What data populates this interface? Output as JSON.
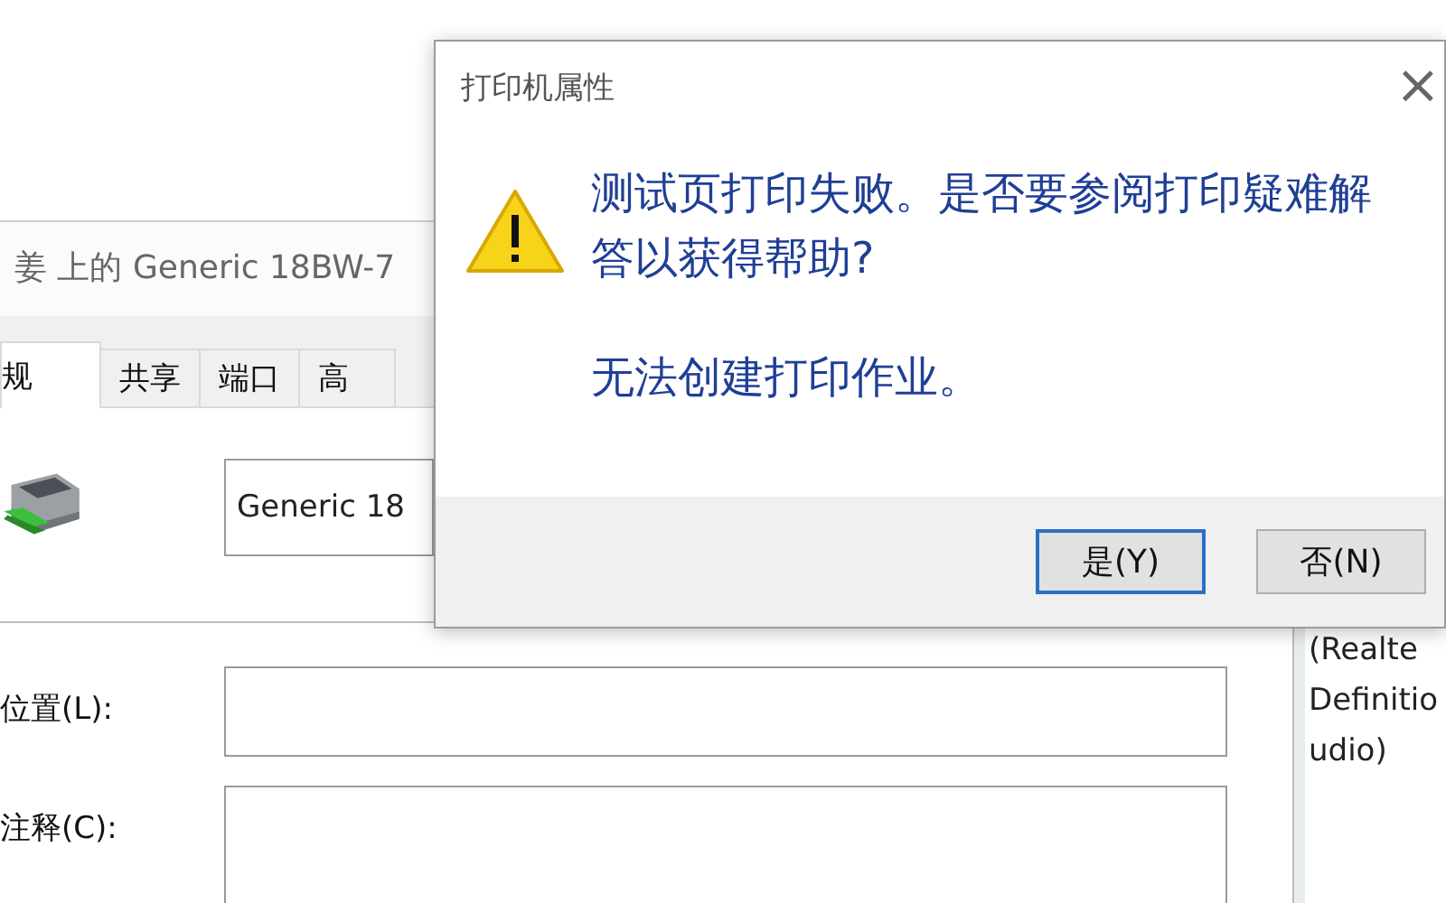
{
  "back_window": {
    "title": "姜 上的 Generic 18BW-7",
    "tabs": [
      {
        "label": "规",
        "selected": true
      },
      {
        "label": "共享",
        "selected": false
      },
      {
        "label": "端口",
        "selected": false
      },
      {
        "label": "高",
        "selected": false
      }
    ],
    "printer_name": {
      "value": "Generic 18"
    },
    "fields": [
      {
        "label": "位置(L):"
      },
      {
        "label": "注释(C):"
      }
    ]
  },
  "side_window": {
    "lines": [
      "(Realte",
      "Definitio",
      "udio)"
    ]
  },
  "dialog": {
    "title": "打印机属性",
    "close": "×",
    "message": "测试页打印失败。是否要参阅打印疑难解答以获得帮助?",
    "detail": "无法创建打印作业。",
    "buttons": [
      {
        "label": "是(Y)",
        "selected": true
      },
      {
        "label": "否(N)",
        "selected": false
      }
    ]
  }
}
